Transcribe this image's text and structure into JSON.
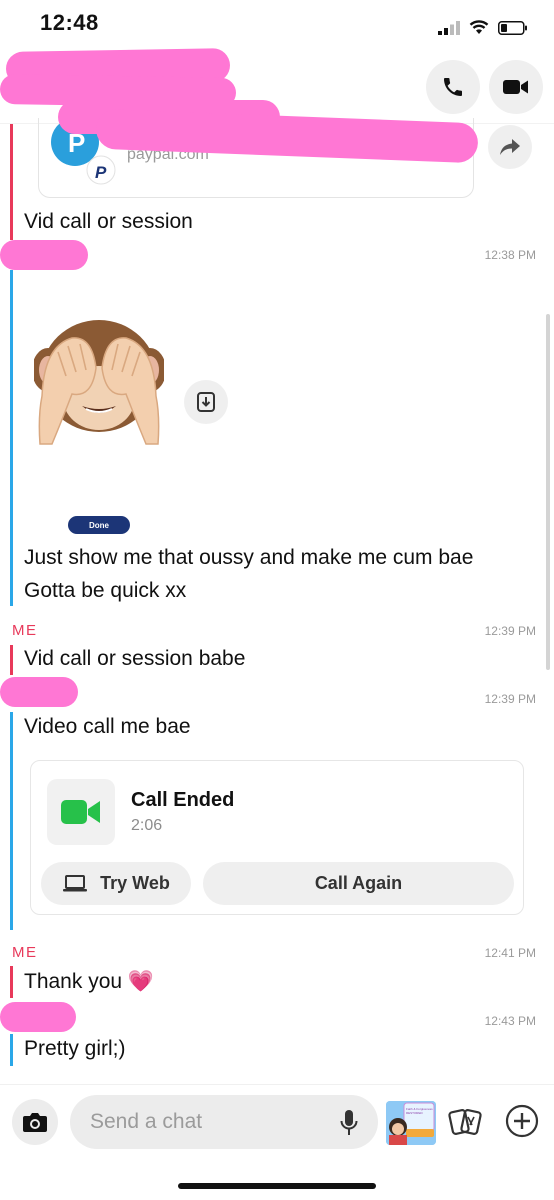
{
  "status_bar": {
    "time": "12:48"
  },
  "link_preview": {
    "domain": "paypal.com"
  },
  "messages": [
    {
      "text": "Vid call or session"
    },
    {
      "timestamp": "12:38 PM"
    },
    {
      "sticker_label": "Done"
    },
    {
      "text": "Just show me that oussy and make me cum bae"
    },
    {
      "text": "Gotta be quick xx"
    },
    {
      "sender": "ME",
      "timestamp": "12:39 PM"
    },
    {
      "text": "Vid call or session babe"
    },
    {
      "timestamp": "12:39 PM"
    },
    {
      "text": "Video call me bae"
    },
    {
      "sender": "ME",
      "timestamp": "12:41 PM"
    },
    {
      "text": "Thank you 💗"
    },
    {
      "timestamp": "12:43 PM"
    },
    {
      "text": "Pretty girl;)"
    }
  ],
  "call_card": {
    "title": "Call Ended",
    "duration": "2:06",
    "try_web_label": "Try Web",
    "call_again_label": "Call Again"
  },
  "composer": {
    "placeholder": "Send a chat",
    "bitmoji_text": "Faith & Forgiveness RESTORED"
  },
  "colors": {
    "me_accent": "#e8395a",
    "friend_accent": "#2aa7e8",
    "redaction": "#ff77d4",
    "call_green": "#27c14a"
  }
}
